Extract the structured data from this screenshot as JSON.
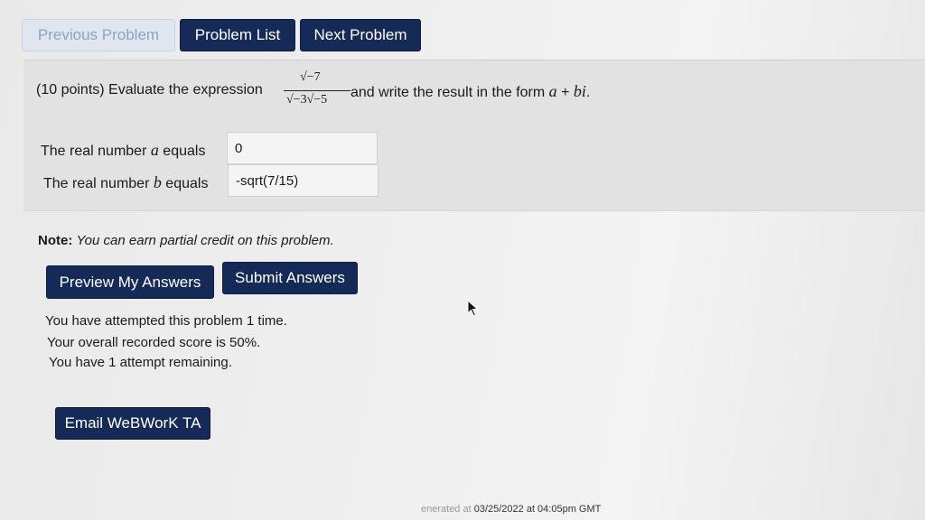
{
  "nav": {
    "previous_label": "Previous Problem",
    "list_label": "Problem List",
    "next_label": "Next Problem"
  },
  "problem": {
    "statement_prefix": "(10 points) Evaluate the expression",
    "numerator": "√−7",
    "denominator": "√−3√−5",
    "statement_suffix": "and write the result in the form",
    "form_a": "a",
    "form_plus": " + ",
    "form_bi": "bi",
    "form_period": ".",
    "real_a_label_prefix": "The real number",
    "real_a_var": "a",
    "real_a_label_suffix": "equals",
    "real_a_value": "0",
    "real_b_label_prefix": "The real number",
    "real_b_var": "b",
    "real_b_label_suffix": "equals",
    "real_b_value": "-sqrt(7/15)"
  },
  "note": {
    "label": "Note:",
    "text": "You can earn partial credit on this problem."
  },
  "actions": {
    "preview_label": "Preview My Answers",
    "submit_label": "Submit Answers",
    "email_label": "Email WeBWorK TA"
  },
  "status": {
    "attempts": "You have attempted this problem 1 time.",
    "score": "Your overall recorded score is 50%.",
    "remaining": "You have 1 attempt remaining."
  },
  "footer": {
    "text_prefix": "enerated at",
    "timestamp": "03/25/2022 at 04:05pm GMT"
  },
  "colors": {
    "button_dark": "#152a57",
    "button_disabled": "#dfe6ef",
    "problem_background": "#e2e2e2"
  }
}
